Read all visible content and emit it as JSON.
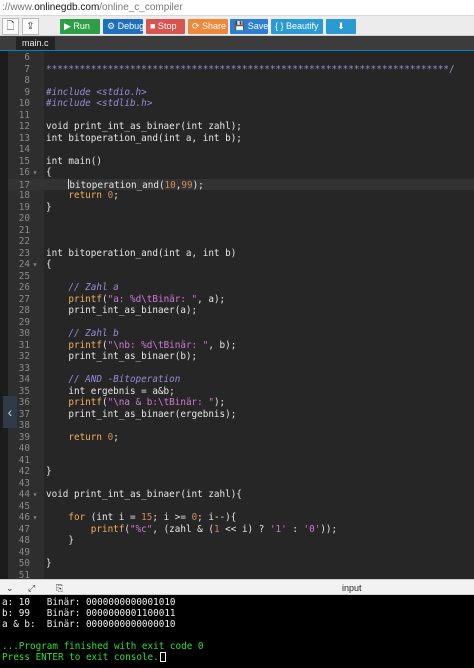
{
  "browser": {
    "url_prefix": "://www.",
    "url_host": "onlinegdb.com",
    "url_path": "/online_c_compiler"
  },
  "toolbar": {
    "file_icon": "file-icon",
    "upload_icon": "upload-icon",
    "buttons": [
      {
        "key": "run",
        "label": "▶ Run",
        "color": "#2e9e46"
      },
      {
        "key": "debug",
        "label": "⚙ Debug",
        "color": "#1f6fbf"
      },
      {
        "key": "stop",
        "label": "■ Stop",
        "color": "#d9534f"
      },
      {
        "key": "share",
        "label": "⟳ Share",
        "color": "#f0883a"
      },
      {
        "key": "save",
        "label": "💾 Save",
        "color": "#2a7fd4"
      },
      {
        "key": "beautify",
        "label": "{ } Beautify",
        "color": "#2a9ad4"
      },
      {
        "key": "download",
        "label": "⬇",
        "color": "#2a9ad4"
      }
    ]
  },
  "editor": {
    "tab": "main.c",
    "lines": [
      {
        "n": "6",
        "fold": "",
        "segs": []
      },
      {
        "n": "7",
        "fold": "",
        "segs": [
          {
            "t": "************************************************************************/",
            "c": "t-star"
          }
        ]
      },
      {
        "n": "8",
        "fold": "",
        "segs": []
      },
      {
        "n": "9",
        "fold": "",
        "segs": [
          {
            "t": "#include <stdio.h>",
            "c": "t-com"
          }
        ]
      },
      {
        "n": "10",
        "fold": "",
        "segs": [
          {
            "t": "#include <stdlib.h>",
            "c": "t-com"
          }
        ]
      },
      {
        "n": "11",
        "fold": "",
        "segs": []
      },
      {
        "n": "12",
        "fold": "",
        "segs": [
          {
            "t": "void print_int_as_binaer(int zahl);",
            "c": ""
          }
        ]
      },
      {
        "n": "13",
        "fold": "",
        "segs": [
          {
            "t": "int bitoperation_and(int a, int b);",
            "c": ""
          }
        ]
      },
      {
        "n": "14",
        "fold": "",
        "segs": []
      },
      {
        "n": "15",
        "fold": "",
        "segs": [
          {
            "t": "int main()",
            "c": ""
          }
        ]
      },
      {
        "n": "16",
        "fold": "▾",
        "segs": [
          {
            "t": "{",
            "c": ""
          }
        ]
      },
      {
        "n": "17",
        "fold": "",
        "active": true,
        "segs": [
          {
            "t": "    ",
            "c": ""
          },
          {
            "cursor": true
          },
          {
            "t": "bitoperation_and(",
            "c": ""
          },
          {
            "t": "10",
            "c": "t-num"
          },
          {
            "t": ",",
            "c": ""
          },
          {
            "t": "99",
            "c": "t-num"
          },
          {
            "t": ");",
            "c": ""
          }
        ]
      },
      {
        "n": "18",
        "fold": "",
        "segs": [
          {
            "t": "    ",
            "c": ""
          },
          {
            "t": "return",
            "c": "t-kw"
          },
          {
            "t": " ",
            "c": ""
          },
          {
            "t": "0",
            "c": "t-num"
          },
          {
            "t": ";",
            "c": ""
          }
        ]
      },
      {
        "n": "19",
        "fold": "",
        "segs": [
          {
            "t": "}",
            "c": ""
          }
        ]
      },
      {
        "n": "20",
        "fold": "",
        "segs": []
      },
      {
        "n": "21",
        "fold": "",
        "segs": []
      },
      {
        "n": "22",
        "fold": "",
        "segs": []
      },
      {
        "n": "23",
        "fold": "",
        "segs": [
          {
            "t": "int bitoperation_and(int a, int b)",
            "c": ""
          }
        ]
      },
      {
        "n": "24",
        "fold": "▾",
        "segs": [
          {
            "t": "{",
            "c": ""
          }
        ]
      },
      {
        "n": "25",
        "fold": "",
        "segs": []
      },
      {
        "n": "26",
        "fold": "",
        "segs": [
          {
            "t": "    ",
            "c": ""
          },
          {
            "t": "// Zahl a",
            "c": "t-com"
          }
        ]
      },
      {
        "n": "27",
        "fold": "",
        "segs": [
          {
            "t": "    ",
            "c": ""
          },
          {
            "t": "printf",
            "c": "t-kw"
          },
          {
            "t": "(",
            "c": ""
          },
          {
            "t": "\"a: %d\\tBinär: \"",
            "c": "t-str"
          },
          {
            "t": ", a);",
            "c": ""
          }
        ]
      },
      {
        "n": "28",
        "fold": "",
        "segs": [
          {
            "t": "    print_int_as_binaer(a);",
            "c": ""
          }
        ]
      },
      {
        "n": "29",
        "fold": "",
        "segs": []
      },
      {
        "n": "30",
        "fold": "",
        "segs": [
          {
            "t": "    ",
            "c": ""
          },
          {
            "t": "// Zahl b",
            "c": "t-com"
          }
        ]
      },
      {
        "n": "31",
        "fold": "",
        "segs": [
          {
            "t": "    ",
            "c": ""
          },
          {
            "t": "printf",
            "c": "t-kw"
          },
          {
            "t": "(",
            "c": ""
          },
          {
            "t": "\"\\nb: %d\\tBinär: \"",
            "c": "t-str"
          },
          {
            "t": ", b);",
            "c": ""
          }
        ]
      },
      {
        "n": "32",
        "fold": "",
        "segs": [
          {
            "t": "    print_int_as_binaer(b);",
            "c": ""
          }
        ]
      },
      {
        "n": "33",
        "fold": "",
        "segs": []
      },
      {
        "n": "34",
        "fold": "",
        "segs": [
          {
            "t": "    ",
            "c": ""
          },
          {
            "t": "// AND -Bitoperation",
            "c": "t-com"
          }
        ]
      },
      {
        "n": "35",
        "fold": "",
        "segs": [
          {
            "t": "    int ergebnis = a&b;",
            "c": ""
          }
        ]
      },
      {
        "n": "36",
        "fold": "",
        "segs": [
          {
            "t": "    ",
            "c": ""
          },
          {
            "t": "printf",
            "c": "t-kw"
          },
          {
            "t": "(",
            "c": ""
          },
          {
            "t": "\"\\na & b:\\tBinär: \"",
            "c": "t-str"
          },
          {
            "t": ");",
            "c": ""
          }
        ]
      },
      {
        "n": "37",
        "fold": "",
        "segs": [
          {
            "t": "    print_int_as_binaer(ergebnis);",
            "c": ""
          }
        ]
      },
      {
        "n": "38",
        "fold": "",
        "segs": []
      },
      {
        "n": "39",
        "fold": "",
        "segs": [
          {
            "t": "    ",
            "c": ""
          },
          {
            "t": "return",
            "c": "t-kw"
          },
          {
            "t": " ",
            "c": ""
          },
          {
            "t": "0",
            "c": "t-num"
          },
          {
            "t": ";",
            "c": ""
          }
        ]
      },
      {
        "n": "40",
        "fold": "",
        "segs": []
      },
      {
        "n": "41",
        "fold": "",
        "segs": []
      },
      {
        "n": "42",
        "fold": "",
        "segs": [
          {
            "t": "}",
            "c": ""
          }
        ]
      },
      {
        "n": "43",
        "fold": "",
        "segs": []
      },
      {
        "n": "44",
        "fold": "▾",
        "segs": [
          {
            "t": "void print_int_as_binaer(int zahl){",
            "c": ""
          }
        ]
      },
      {
        "n": "45",
        "fold": "",
        "segs": []
      },
      {
        "n": "46",
        "fold": "▾",
        "segs": [
          {
            "t": "    ",
            "c": ""
          },
          {
            "t": "for",
            "c": "t-kw"
          },
          {
            "t": " (int i = ",
            "c": ""
          },
          {
            "t": "15",
            "c": "t-num"
          },
          {
            "t": "; i >= ",
            "c": ""
          },
          {
            "t": "0",
            "c": "t-num"
          },
          {
            "t": "; i--){",
            "c": ""
          }
        ]
      },
      {
        "n": "47",
        "fold": "",
        "segs": [
          {
            "t": "        ",
            "c": ""
          },
          {
            "t": "printf",
            "c": "t-kw"
          },
          {
            "t": "(",
            "c": ""
          },
          {
            "t": "\"%c\"",
            "c": "t-str"
          },
          {
            "t": ", (zahl & (",
            "c": ""
          },
          {
            "t": "1",
            "c": "t-num"
          },
          {
            "t": " << i) ? ",
            "c": ""
          },
          {
            "t": "'1'",
            "c": "t-str"
          },
          {
            "t": " : ",
            "c": ""
          },
          {
            "t": "'0'",
            "c": "t-str"
          },
          {
            "t": "));",
            "c": ""
          }
        ]
      },
      {
        "n": "48",
        "fold": "",
        "segs": [
          {
            "t": "    }",
            "c": ""
          }
        ]
      },
      {
        "n": "49",
        "fold": "",
        "segs": []
      },
      {
        "n": "50",
        "fold": "",
        "segs": [
          {
            "t": "}",
            "c": ""
          }
        ]
      },
      {
        "n": "51",
        "fold": "",
        "segs": []
      }
    ]
  },
  "io": {
    "label": "input",
    "icons": [
      "expand-icon",
      "resize-icon",
      "copy-icon"
    ]
  },
  "console": {
    "lines": [
      {
        "text": "a: 10   Binär: 0000000000001010",
        "green": false
      },
      {
        "text": "b: 99   Binär: 0000000001100011",
        "green": false
      },
      {
        "text": "a & b:  Binär: 0000000000000010",
        "green": false
      },
      {
        "text": "",
        "green": false
      },
      {
        "text": "...Program finished with exit code 0",
        "green": true
      },
      {
        "text": "Press ENTER to exit console.",
        "green": true,
        "cursor": true
      }
    ]
  },
  "colors": {
    "editor_bg": "#262626",
    "console_bg": "#000000",
    "console_green": "#30e030",
    "tab_accent": "#0a7ec8"
  }
}
